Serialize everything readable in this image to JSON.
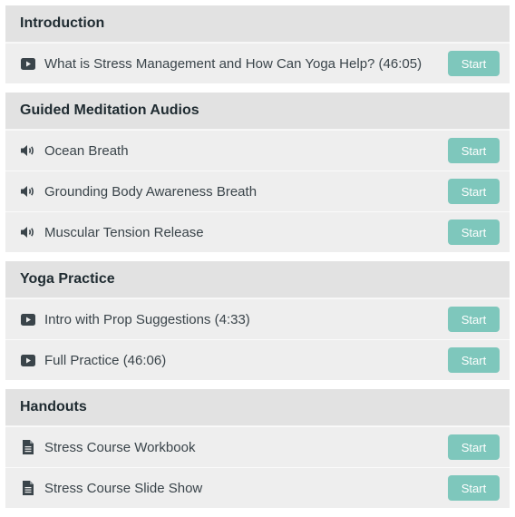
{
  "sections": [
    {
      "title": "Introduction",
      "lessons": [
        {
          "icon": "video-icon",
          "title": "What is Stress Management and How Can Yoga Help? (46:05)",
          "action": "Start"
        }
      ]
    },
    {
      "title": "Guided Meditation Audios",
      "lessons": [
        {
          "icon": "audio-icon",
          "title": "Ocean Breath",
          "action": "Start"
        },
        {
          "icon": "audio-icon",
          "title": "Grounding Body Awareness Breath",
          "action": "Start"
        },
        {
          "icon": "audio-icon",
          "title": "Muscular Tension Release",
          "action": "Start"
        }
      ]
    },
    {
      "title": "Yoga Practice",
      "lessons": [
        {
          "icon": "video-icon",
          "title": "Intro with Prop Suggestions (4:33)",
          "action": "Start"
        },
        {
          "icon": "video-icon",
          "title": "Full Practice (46:06)",
          "action": "Start"
        }
      ]
    },
    {
      "title": "Handouts",
      "lessons": [
        {
          "icon": "document-icon",
          "title": "Stress Course Workbook",
          "action": "Start"
        },
        {
          "icon": "document-icon",
          "title": "Stress Course Slide Show",
          "action": "Start"
        }
      ]
    }
  ],
  "colors": {
    "button_bg": "#7ec7bc",
    "section_header_bg": "#e2e2e2",
    "row_bg": "#eeeeee",
    "icon": "#3a444a"
  }
}
